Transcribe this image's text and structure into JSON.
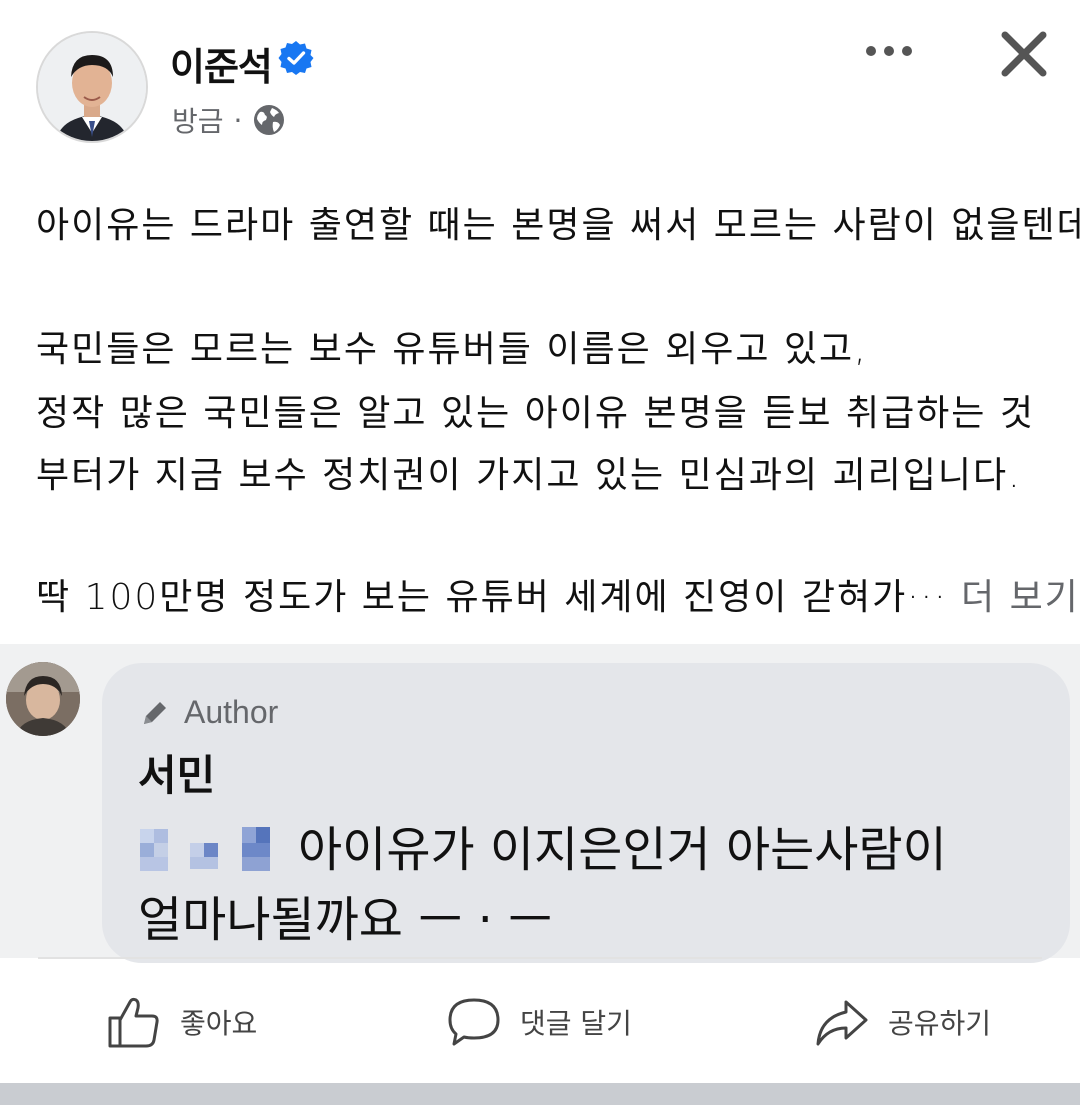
{
  "post": {
    "author": "이준석",
    "time": "방금",
    "separator": "·",
    "lines": [
      "아이유는 드라마 출연할 때는 본명을 써서 모르는 사람이 없을텐데,",
      "국민들은 모르는 보수 유튜버들 이름은 외우고 있고,",
      "정작 많은 국민들은 알고 있는 아이유 본명을 듣보 취급하는 것",
      "부터가 지금 보수 정치권이 가지고 있는 민심과의 괴리입니다.",
      "딱 100만명 정도가 보는 유튜버 세계에 진영이 갇혀가···"
    ],
    "see_more": "더 보기"
  },
  "comment": {
    "badge": "Author",
    "name": "서민",
    "lines": [
      "아이유가 이지은인거 아는사람이",
      "얼마나될까요 ㅡ · ㅡ"
    ]
  },
  "actions": {
    "like": "좋아요",
    "comment": "댓글 달기",
    "share": "공유하기"
  },
  "colors": {
    "verified": "#1877f2",
    "secondary_text": "#65676b",
    "bubble": "#e4e6ea"
  },
  "icons": [
    "verified-badge-icon",
    "globe-icon",
    "more-icon",
    "close-icon",
    "pencil-icon",
    "like-icon",
    "comment-icon",
    "share-icon"
  ]
}
